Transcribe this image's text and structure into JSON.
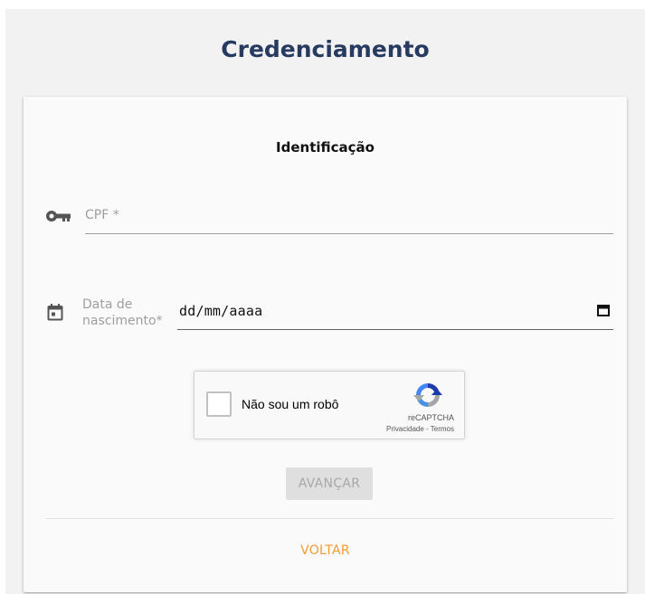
{
  "header": {
    "title": "Credenciamento"
  },
  "form": {
    "section_title": "Identificação",
    "cpf": {
      "label": "CPF *",
      "icon": "key-icon",
      "value": ""
    },
    "birth_date": {
      "label_line1": "Data de",
      "label_line2": "nascimento*",
      "value": "dd/mm/aaaa",
      "icon": "calendar-icon"
    }
  },
  "recaptcha": {
    "label": "Não sou um robô",
    "brand": "reCAPTCHA",
    "privacy": "Privacidade",
    "separator": " - ",
    "terms": "Termos"
  },
  "actions": {
    "advance_label": "AVANÇAR",
    "back_label": "VOLTAR"
  },
  "colors": {
    "title": "#273a60",
    "accent": "#f39c33",
    "disabled_button": "#dfdfdf"
  }
}
